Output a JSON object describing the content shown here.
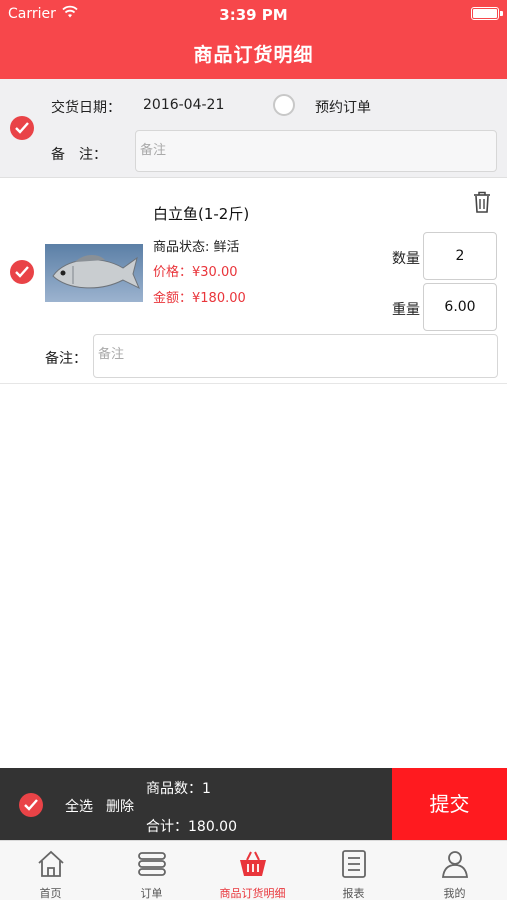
{
  "status_bar": {
    "carrier": "Carrier",
    "time": "3:39 PM"
  },
  "header": {
    "title": "商品订货明细"
  },
  "order": {
    "delivery_label": "交货日期：",
    "delivery_date": "2016-04-21",
    "reserve_label": "预约订单",
    "remark_label": "备　注：",
    "remark_placeholder": "备注"
  },
  "item": {
    "name": "白立鱼(1-2斤)",
    "state": "商品状态: 鲜活",
    "price": "价格：¥30.00",
    "amount": "金额：¥180.00",
    "qty_label": "数量",
    "qty_value": "2",
    "weight_label": "重量",
    "weight_value": "6.00",
    "remark_label": "备注：",
    "remark_placeholder": "备注"
  },
  "bottom": {
    "select_all": "全选",
    "delete": "删除",
    "count": "商品数：1",
    "total": "合计：180.00",
    "submit": "提交"
  },
  "tabs": [
    {
      "label": "首页",
      "icon": "home-icon"
    },
    {
      "label": "订单",
      "icon": "list-icon"
    },
    {
      "label": "商品订货明细",
      "icon": "basket-icon"
    },
    {
      "label": "报表",
      "icon": "report-icon"
    },
    {
      "label": "我的",
      "icon": "user-icon"
    }
  ],
  "colors": {
    "brand_red": "#f7474b",
    "check_red": "#e94347",
    "submit_red": "#ff1a1f",
    "bar_dark": "#333333"
  }
}
